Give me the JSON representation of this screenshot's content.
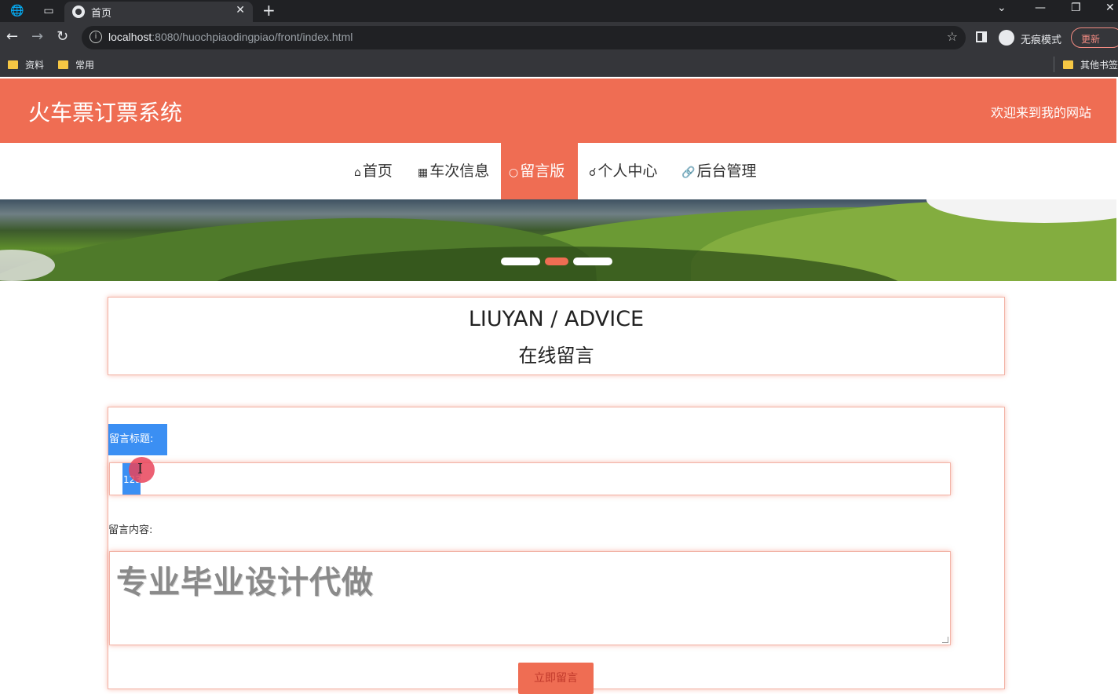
{
  "browser": {
    "tab_title": "首页",
    "url_host": "localhost",
    "url_rest": ":8080/huochpiaodingpiao/front/index.html",
    "incognito_label": "无痕模式",
    "update_label": "更新",
    "bookmarks": [
      {
        "label": "资料"
      },
      {
        "label": "常用"
      }
    ],
    "other_bookmarks": "其他书签"
  },
  "header": {
    "site_title": "火车票订票系统",
    "welcome": "欢迎来到我的网站",
    "brand_color": "#ef6d53"
  },
  "nav": {
    "items": [
      {
        "icon": "home-icon",
        "label": "首页",
        "active": false
      },
      {
        "icon": "train-icon",
        "label": "车次信息",
        "active": false
      },
      {
        "icon": "circle-icon",
        "label": "留言版",
        "active": true
      },
      {
        "icon": "user-icon",
        "label": "个人中心",
        "active": false
      },
      {
        "icon": "link-icon",
        "label": "后台管理",
        "active": false
      }
    ]
  },
  "carousel": {
    "slide_count": 3,
    "active_index": 1
  },
  "section": {
    "title_en": "LIUYAN / ADVICE",
    "title_cn": "在线留言"
  },
  "form": {
    "title_label": "留言标题:",
    "title_value": "123",
    "content_label": "留言内容:",
    "content_watermark": "专业毕业设计代做",
    "submit_label": "立即留言"
  }
}
